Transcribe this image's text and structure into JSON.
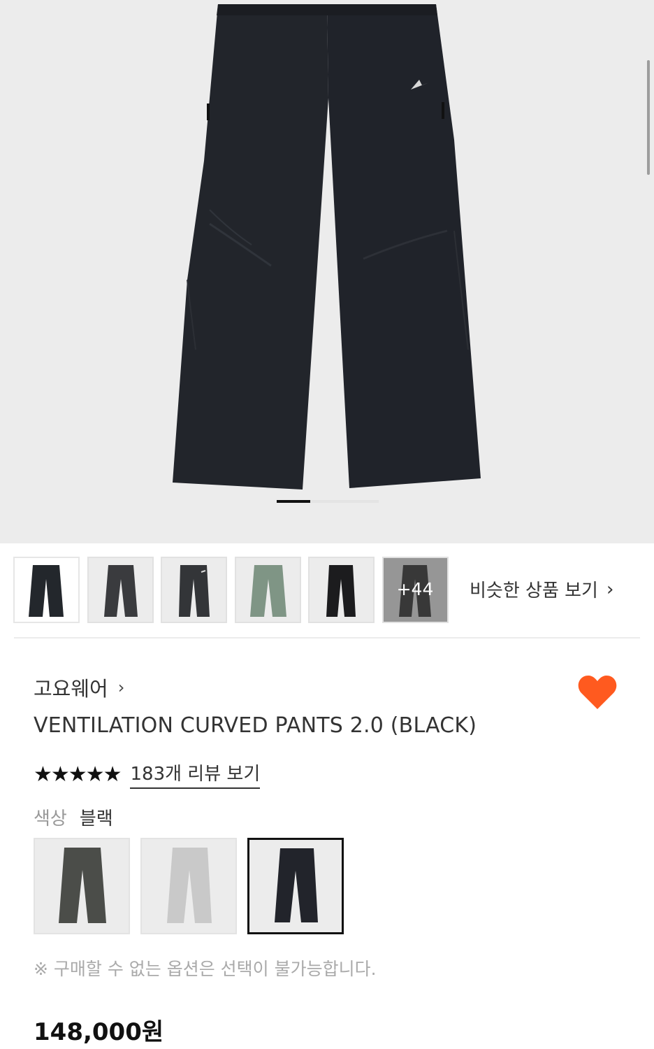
{
  "hero": {
    "image_description_icon": "pants-product-photo",
    "pager_fraction": 0.33
  },
  "thumbnails": {
    "items": [
      {
        "color": "#23272c"
      },
      {
        "color": "#3a3b3e"
      },
      {
        "color": "#333538"
      },
      {
        "color": "#7f9585"
      },
      {
        "color": "#1c1c1e"
      },
      {
        "color": "#1b1b1b"
      }
    ],
    "more_count": "+44",
    "similar_label": "비슷한 상품 보기",
    "similar_chevron": "›"
  },
  "product": {
    "brand": "고요웨어",
    "brand_chevron": "›",
    "title": "VENTILATION CURVED PANTS 2.0 (BLACK)",
    "stars": "★★★★★",
    "review_link": "183개 리뷰 보기",
    "color_label": "색상",
    "color_value": "블랙",
    "swatches": [
      {
        "color": "#4b4d49"
      },
      {
        "color": "#c9c9c9"
      },
      {
        "color": "#22242b"
      }
    ],
    "note": "※ 구매할 수 없는 옵션은 선택이 불가능합니다.",
    "price": "148,000원",
    "heart_color": "#ff5a1f"
  }
}
